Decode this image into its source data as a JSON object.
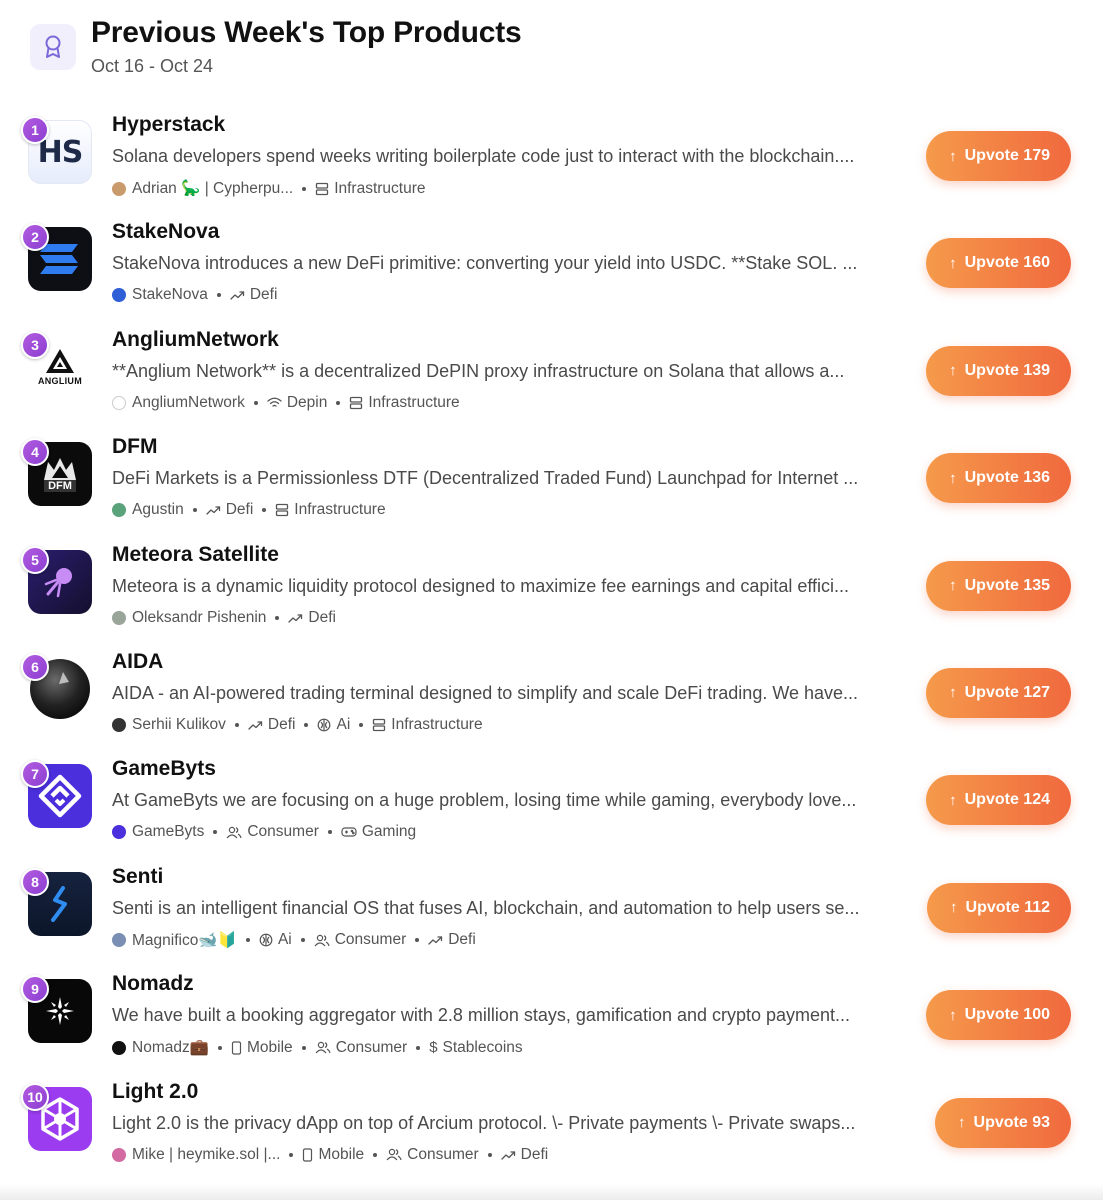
{
  "header": {
    "icon": "award-ribbon-icon",
    "title": "Previous Week's Top Products",
    "date_range": "Oct 16 - Oct 24"
  },
  "products": [
    {
      "rank": "1",
      "name": "Hyperstack",
      "description": "Solana developers spend weeks writing boilerplate code just to interact with the blockchain....",
      "maker": "Adrian 🦕 | Cypherpu...",
      "tags": [
        {
          "icon": "server-icon",
          "label": "Infrastructure"
        }
      ],
      "upvote": "Upvote 179",
      "logo_text": "HS"
    },
    {
      "rank": "2",
      "name": "StakeNova",
      "description": "StakeNova introduces a new DeFi primitive: converting your yield into USDC. **Stake SOL. ...",
      "maker": "StakeNova",
      "tags": [
        {
          "icon": "trend-icon",
          "label": "Defi"
        }
      ],
      "upvote": "Upvote 160",
      "logo_text": ""
    },
    {
      "rank": "3",
      "name": "AngliumNetwork",
      "description": "**Anglium Network** is a decentralized DePIN proxy infrastructure on Solana that allows a...",
      "maker": "AngliumNetwork",
      "tags": [
        {
          "icon": "wifi-icon",
          "label": "Depin"
        },
        {
          "icon": "server-icon",
          "label": "Infrastructure"
        }
      ],
      "upvote": "Upvote 139",
      "logo_text": "ANGLIUM"
    },
    {
      "rank": "4",
      "name": "DFM",
      "description": "DeFi Markets is a Permissionless DTF (Decentralized Traded Fund) Launchpad for Internet ...",
      "maker": "Agustin",
      "tags": [
        {
          "icon": "trend-icon",
          "label": "Defi"
        },
        {
          "icon": "server-icon",
          "label": "Infrastructure"
        }
      ],
      "upvote": "Upvote 136",
      "logo_text": "DFM"
    },
    {
      "rank": "5",
      "name": "Meteora Satellite",
      "description": "Meteora is a dynamic liquidity protocol designed to maximize fee earnings and capital effici...",
      "maker": "Oleksandr Pishenin",
      "tags": [
        {
          "icon": "trend-icon",
          "label": "Defi"
        }
      ],
      "upvote": "Upvote 135",
      "logo_text": ""
    },
    {
      "rank": "6",
      "name": "AIDA",
      "description": "AIDA - an AI-powered trading terminal designed to simplify and scale DeFi trading. We have...",
      "maker": "Serhii Kulikov",
      "tags": [
        {
          "icon": "trend-icon",
          "label": "Defi"
        },
        {
          "icon": "brain-icon",
          "label": "Ai"
        },
        {
          "icon": "server-icon",
          "label": "Infrastructure"
        }
      ],
      "upvote": "Upvote 127",
      "logo_text": ""
    },
    {
      "rank": "7",
      "name": "GameByts",
      "description": "At GameByts we are focusing on a huge problem, losing time while gaming, everybody love...",
      "maker": "GameByts",
      "tags": [
        {
          "icon": "users-icon",
          "label": "Consumer"
        },
        {
          "icon": "gamepad-icon",
          "label": "Gaming"
        }
      ],
      "upvote": "Upvote 124",
      "logo_text": ""
    },
    {
      "rank": "8",
      "name": "Senti",
      "description": "Senti is an intelligent financial OS that fuses AI, blockchain, and automation to help users se...",
      "maker": "Magnifico🐋🔰",
      "tags": [
        {
          "icon": "brain-icon",
          "label": "Ai"
        },
        {
          "icon": "users-icon",
          "label": "Consumer"
        },
        {
          "icon": "trend-icon",
          "label": "Defi"
        }
      ],
      "upvote": "Upvote 112",
      "logo_text": ""
    },
    {
      "rank": "9",
      "name": "Nomadz",
      "description": "We have built a booking aggregator with 2.8 million stays, gamification and crypto payment...",
      "maker": "Nomadz💼",
      "tags": [
        {
          "icon": "mobile-icon",
          "label": "Mobile"
        },
        {
          "icon": "users-icon",
          "label": "Consumer"
        },
        {
          "icon": "dollar-icon",
          "label": "Stablecoins"
        }
      ],
      "upvote": "Upvote 100",
      "logo_text": ""
    },
    {
      "rank": "10",
      "name": "Light 2.0",
      "description": "Light 2.0 is the privacy dApp on top of Arcium protocol. \\- Private payments \\- Private swaps...",
      "maker": "Mike | heymike.sol |...",
      "tags": [
        {
          "icon": "mobile-icon",
          "label": "Mobile"
        },
        {
          "icon": "users-icon",
          "label": "Consumer"
        },
        {
          "icon": "trend-icon",
          "label": "Defi"
        }
      ],
      "upvote": "Upvote 93",
      "logo_text": ""
    }
  ],
  "colors": {
    "upvote_start": "#f59a4b",
    "upvote_end": "#f0693e",
    "rank_badge": "#9b4bd8"
  }
}
